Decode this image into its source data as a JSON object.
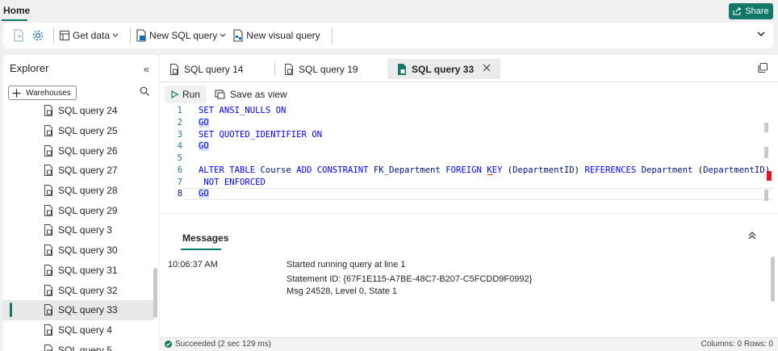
{
  "header": {
    "home_tab": "Home",
    "share_label": "Share"
  },
  "ribbon": {
    "get_data_label": "Get data",
    "new_sql_query_label": "New SQL query",
    "new_visual_query_label": "New visual query"
  },
  "explorer": {
    "title": "Explorer",
    "warehouses_label": "Warehouses",
    "items": [
      {
        "label": "SQL query 24"
      },
      {
        "label": "SQL query 25"
      },
      {
        "label": "SQL query 26"
      },
      {
        "label": "SQL query 27"
      },
      {
        "label": "SQL query 28"
      },
      {
        "label": "SQL query 29"
      },
      {
        "label": "SQL query 3"
      },
      {
        "label": "SQL query 30"
      },
      {
        "label": "SQL query 31"
      },
      {
        "label": "SQL query 32"
      },
      {
        "label": "SQL query 33"
      },
      {
        "label": "SQL query 4"
      },
      {
        "label": "SQL query 5"
      }
    ],
    "selected": "SQL query 33"
  },
  "tabs": [
    {
      "label": "SQL query 14"
    },
    {
      "label": "SQL query 19"
    },
    {
      "label": "SQL query 33"
    }
  ],
  "toolbar": {
    "run_label": "Run",
    "save_as_view_label": "Save as view"
  },
  "code": {
    "line_numbers": [
      "1",
      "2",
      "3",
      "4",
      "5",
      "6",
      "7",
      "8"
    ],
    "l1_kw": "SET ANSI_NULLS ON",
    "l2_kw": "GO",
    "l3_kw": "SET QUOTED_IDENTIFIER ON",
    "l4_kw": "GO",
    "l6_a": "ALTER TABLE ",
    "l6_b": "Course",
    "l6_c": " ADD CONSTRAINT ",
    "l6_d": "FK_Department",
    "l6_e": " FOREIGN KEY ",
    "l6_f": "(",
    "l6_g": "DepartmentID",
    "l6_h": ")",
    "l6_i": " REFERENCES ",
    "l6_j": "Department",
    "l6_k": " (",
    "l6_l": "DepartmentID",
    "l6_m": ")",
    "l7_kw": " NOT ENFORCED",
    "l8_kw": "GO"
  },
  "messages": {
    "tab_label": "Messages",
    "time": "10:06:37 AM",
    "line1": "Started running query at line 1",
    "line2": "Statement ID: {67F1E115-A7BE-48C7-B207-C5FCDD9F0992}",
    "line3": "Msg 24528, Level 0, State 1"
  },
  "status": {
    "text": "Succeeded (2 sec 129 ms)",
    "right": "Columns: 0  Rows: 0"
  },
  "colors": {
    "accent": "#117865",
    "keyword": "#0000ff",
    "identifier": "#001080",
    "error": "#e81123"
  }
}
